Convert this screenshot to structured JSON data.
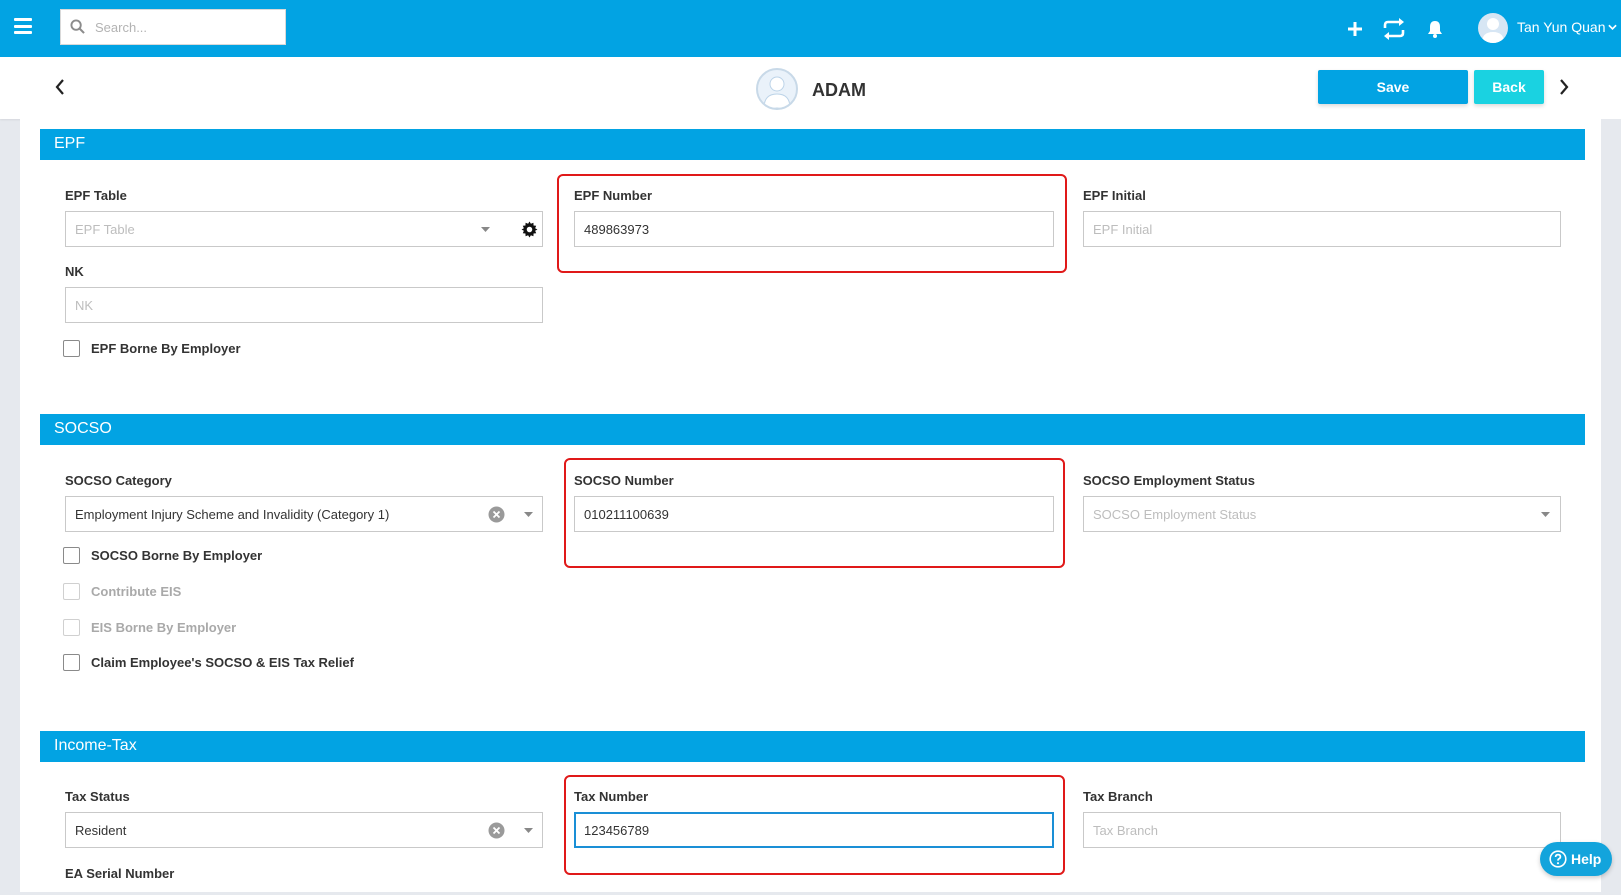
{
  "topbar": {
    "search_placeholder": "Search...",
    "user_name": "Tan Yun Quan",
    "icons": [
      "menu-icon",
      "search-icon",
      "plus-icon",
      "sync-icon",
      "bell-icon",
      "avatar-icon",
      "chevron-down-icon"
    ]
  },
  "header": {
    "employee_name": "ADAM",
    "save_label": "Save",
    "back_label": "Back"
  },
  "epf": {
    "title": "EPF",
    "epf_table_label": "EPF Table",
    "epf_table_placeholder": "EPF Table",
    "epf_number_label": "EPF Number",
    "epf_number_value": "489863973",
    "epf_initial_label": "EPF Initial",
    "epf_initial_placeholder": "EPF Initial",
    "nk_label": "NK",
    "nk_placeholder": "NK",
    "borne_by_employer_label": "EPF Borne By Employer"
  },
  "socso": {
    "title": "SOCSO",
    "category_label": "SOCSO Category",
    "category_value": "Employment Injury Scheme and Invalidity (Category 1)",
    "number_label": "SOCSO Number",
    "number_value": "010211100639",
    "employment_status_label": "SOCSO Employment Status",
    "employment_status_placeholder": "SOCSO Employment Status",
    "borne_by_employer_label": "SOCSO Borne By Employer",
    "contribute_eis_label": "Contribute EIS",
    "eis_borne_label": "EIS Borne By Employer",
    "claim_tax_relief_label": "Claim Employee's SOCSO & EIS Tax Relief"
  },
  "income_tax": {
    "title": "Income-Tax",
    "status_label": "Tax Status",
    "status_value": "Resident",
    "number_label": "Tax Number",
    "number_value": "123456789",
    "branch_label": "Tax Branch",
    "branch_placeholder": "Tax Branch",
    "ea_serial_label": "EA Serial Number"
  },
  "help": {
    "label": "Help"
  },
  "colors": {
    "primary": "#02a3e3",
    "back_button": "#1ad2e1",
    "highlight": "#e01919",
    "focus_border": "#1a8fd6"
  }
}
